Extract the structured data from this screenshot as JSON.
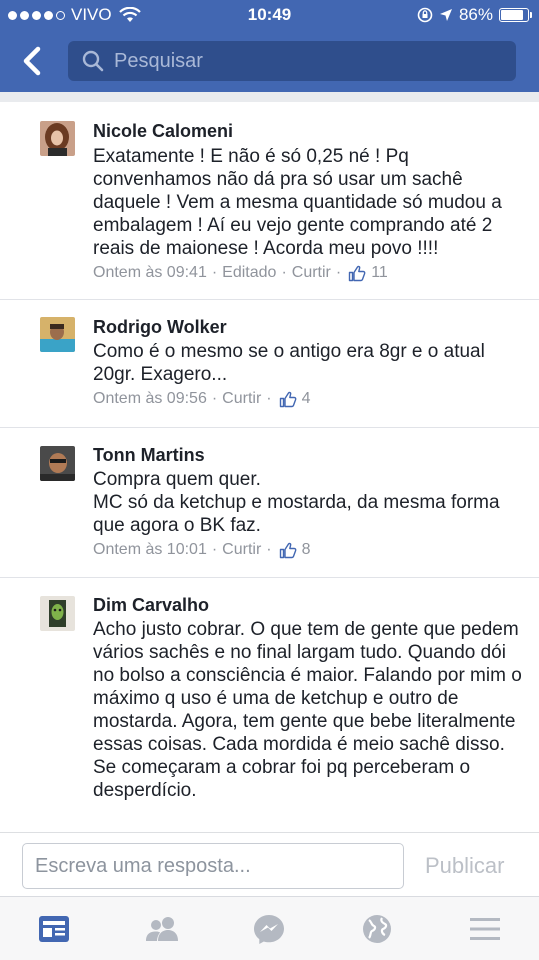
{
  "status_bar": {
    "carrier": "VIVO",
    "time": "10:49",
    "battery": "86%",
    "battery_level": 0.86,
    "signal_bars": 4
  },
  "nav": {
    "search_placeholder": "Pesquisar"
  },
  "comments": [
    {
      "author": "Nicole Calomeni",
      "text": "Exatamente ! E não é só 0,25 né ! Pq convenhamos não dá pra só usar um sachê daquele ! Vem a mesma quantidade só mudou a embalagem ! Aí eu vejo gente comprando até 2 reais de maionese ! Acorda meu povo !!!!",
      "time": "Ontem às 09:41",
      "edited": "Editado",
      "like_label": "Curtir",
      "likes": "11"
    },
    {
      "author": "Rodrigo Wolker",
      "text": "Como é o mesmo se o antigo era 8gr e o atual 20gr. Exagero...",
      "time": "Ontem às 09:56",
      "like_label": "Curtir",
      "likes": "4"
    },
    {
      "author": "Tonn Martins",
      "text": "Compra quem quer.\nMC só da ketchup e mostarda, da mesma forma que agora o BK faz.",
      "time": "Ontem às 10:01",
      "like_label": "Curtir",
      "likes": "8"
    },
    {
      "author": "Dim Carvalho",
      "text": "Acho justo cobrar. O que tem de gente que pedem vários sachês e no final largam tudo. Quando dói no bolso a consciência é maior. Falando por mim o máximo q uso é uma de ketchup e outro de mostarda. Agora, tem gente que bebe literalmente essas coisas. Cada mordida é meio sachê disso. Se começaram a cobrar foi pq perceberam o desperdício."
    }
  ],
  "reply": {
    "placeholder": "Escreva uma resposta...",
    "publish_label": "Publicar"
  },
  "tabs": [
    "news-feed-icon",
    "friends-icon",
    "messenger-icon",
    "globe-icon",
    "menu-icon"
  ],
  "colors": {
    "brand": "#4267b2",
    "search_bg": "#2f4e8c",
    "meta_text": "#90949c",
    "active_tab": "#4267b2",
    "inactive_tab": "#b4b9c2"
  }
}
